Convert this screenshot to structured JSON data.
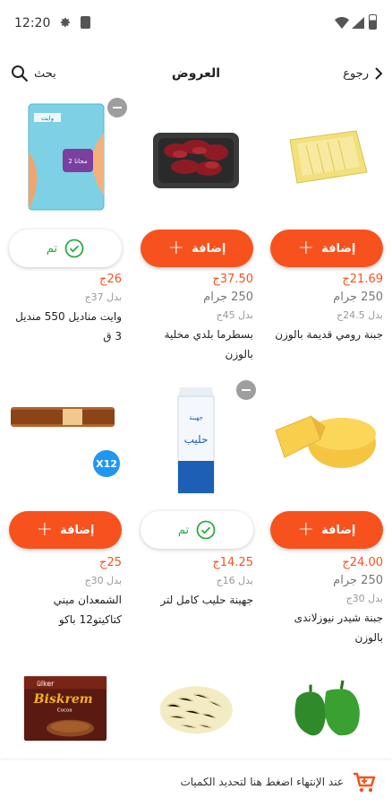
{
  "status_bar": {
    "time": "12:20"
  },
  "header": {
    "back_label": "رجوع",
    "title": "العروض",
    "search_label": "بحث"
  },
  "buttons": {
    "add_label": "إضافة",
    "done_label": "تم",
    "plus": "+"
  },
  "products": [
    {
      "price": "21.69ج",
      "weight": "250 جرام",
      "was": "بدل 24.5ج",
      "name": "جبنة رومي قديمة بالوزن",
      "state": "add"
    },
    {
      "price": "37.50ج",
      "weight": "250 جرام",
      "was": "بدل 45ج",
      "name": "بسطرما بلدي مخلية بالوزن",
      "state": "add"
    },
    {
      "price": "26ج",
      "weight": "",
      "was": "بدل 37ج",
      "name": "وايت مناديل 550 منديل 3 ق",
      "state": "done"
    },
    {
      "price": "24.00ج",
      "weight": "250 جرام",
      "was": "بدل 30ج",
      "name": "جبنة شيدر نيوزلاندى بالوزن",
      "state": "add"
    },
    {
      "price": "14.25ج",
      "weight": "",
      "was": "بدل 16ج",
      "name": "جهينة حليب كامل لتر",
      "state": "done"
    },
    {
      "price": "25ج",
      "weight": "",
      "was": "بدل 30ج",
      "name": "الشمعدان ميني كتاكيتو12 باكو",
      "state": "add",
      "badge": "X12"
    },
    {
      "name": "Biskrem"
    }
  ],
  "tissue_pack": {
    "brand": "وايت",
    "promo": "2 مجانا"
  },
  "milk_pack": {
    "brand": "جهينة",
    "label": "حليب"
  },
  "biskrem_box": {
    "brand": "ülker",
    "name": "Biskrem",
    "sub": "Cocoa"
  },
  "bottom_bar": {
    "text": "عند الإنتهاء اضغط هنا لتحديد الكميات"
  },
  "colors": {
    "accent": "#f7521d",
    "success": "#2eaa3e",
    "badge": "#2196f3"
  }
}
